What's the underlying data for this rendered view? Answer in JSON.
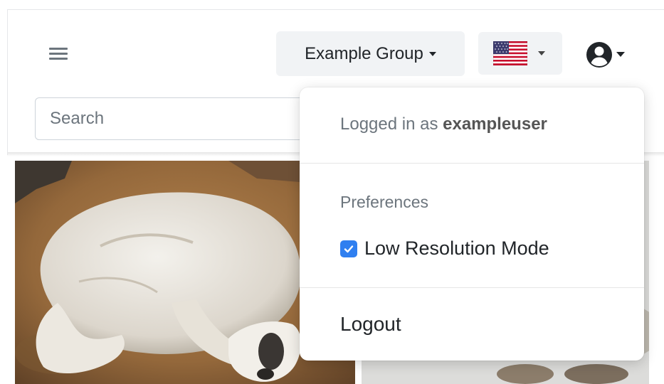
{
  "header": {
    "group_selector": {
      "label": "Example Group"
    },
    "language_selector": {
      "flag_icon": "us-flag-icon"
    },
    "user_menu": {
      "icon": "user-circle-icon"
    }
  },
  "search": {
    "placeholder": "Search",
    "value": ""
  },
  "user_dropdown": {
    "logged_in_prefix": "Logged in as",
    "username": "exampleuser",
    "preferences_header": "Preferences",
    "low_res_mode": {
      "label": "Low Resolution Mode",
      "checked": true
    },
    "logout_label": "Logout"
  },
  "colors": {
    "accent": "#2f7ff0",
    "button_bg": "#f1f3f5",
    "muted_text": "#6c757d"
  }
}
